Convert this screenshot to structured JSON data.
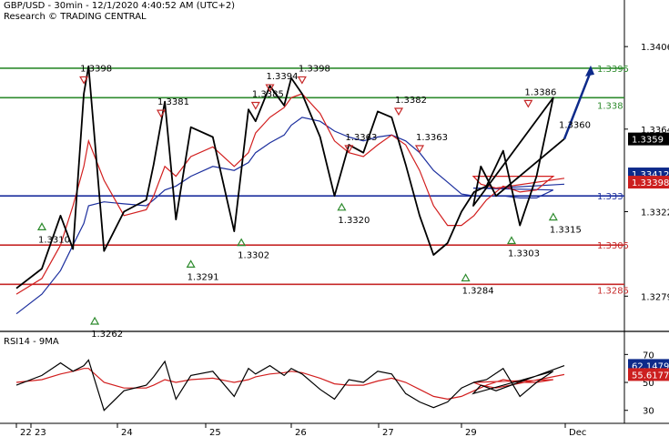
{
  "header": {
    "line1": "GBP/USD - 30min - 12/1/2020 4:40:52 AM (UTC+2)",
    "line2": "Research © TRADING CENTRAL"
  },
  "chart_data": [
    {
      "type": "line",
      "panel": "price",
      "ylim": [
        1.3262,
        1.3426
      ],
      "y_ticks": [
        "1.3406",
        "1.3364",
        "1.3322",
        "1.3279"
      ],
      "x_ticks": [
        "22",
        "23",
        "24",
        "25",
        "26",
        "27",
        "29",
        "Dec"
      ],
      "grid": false,
      "x": [
        "22 18:00",
        "23 00:00",
        "23 06:00",
        "23 10:00",
        "23 13:30",
        "23 15:00",
        "23 20:00",
        "24 02:00",
        "24 08:00",
        "24 10:00",
        "24 13:00",
        "24 16:00",
        "24 20:00",
        "25 02:00",
        "25 08:00",
        "25 12:00",
        "25 14:00",
        "25 18:00",
        "25 22:00",
        "26 00:00",
        "26 03:00",
        "26 08:00",
        "26 12:00",
        "26 16:00",
        "26 20:00",
        "27 00:00",
        "27 04:00",
        "27 08:00",
        "27 12:00",
        "27 16:00",
        "27 20:00",
        "29 00:00",
        "29 03:00",
        "29 06:00",
        "29 10:00",
        "29 14:00",
        "29 18:00",
        "29 22:00",
        "30 00:00",
        "30 02:00",
        "30 06:00",
        "Dec 00:00"
      ],
      "series": [
        {
          "values": [
            1.3283,
            1.3293,
            1.332,
            1.3303,
            1.3382,
            1.3396,
            1.3302,
            1.3322,
            1.3328,
            1.3346,
            1.3378,
            1.3318,
            1.3365,
            1.336,
            1.3312,
            1.3374,
            1.3368,
            1.3386,
            1.3376,
            1.339,
            1.3382,
            1.336,
            1.333,
            1.3356,
            1.3352,
            1.3373,
            1.337,
            1.3346,
            1.332,
            1.33,
            1.3306,
            1.3322,
            1.3332,
            1.3335,
            1.3353,
            1.3315,
            1.334,
            1.338,
            1.3325,
            1.3345,
            1.333,
            1.3359
          ]
        },
        {
          "values": [
            1.328,
            1.3288,
            1.3305,
            1.3325,
            1.3345,
            1.3358,
            1.3338,
            1.332,
            1.3323,
            1.333,
            1.3345,
            1.334,
            1.335,
            1.3355,
            1.3345,
            1.3352,
            1.3362,
            1.337,
            1.3375,
            1.338,
            1.3382,
            1.3372,
            1.3358,
            1.3352,
            1.335,
            1.3356,
            1.3361,
            1.3356,
            1.3343,
            1.3325,
            1.3315,
            1.3315,
            1.332,
            1.3328,
            1.3335,
            1.3332,
            1.3333,
            1.334,
            1.334,
            1.3336,
            1.3334,
            1.3339
          ]
        },
        {
          "values": [
            1.327,
            1.328,
            1.3292,
            1.3305,
            1.3316,
            1.3325,
            1.3327,
            1.3326,
            1.3325,
            1.3328,
            1.3333,
            1.3335,
            1.334,
            1.3345,
            1.3343,
            1.3347,
            1.3352,
            1.3357,
            1.3361,
            1.3366,
            1.337,
            1.3368,
            1.3363,
            1.336,
            1.3358,
            1.336,
            1.3361,
            1.3358,
            1.3352,
            1.3343,
            1.3337,
            1.3331,
            1.333,
            1.333,
            1.333,
            1.3329,
            1.3329,
            1.3333,
            1.3334,
            1.3334,
            1.3334,
            1.3336
          ]
        }
      ],
      "levels": [
        {
          "value": "1.3395",
          "color": "#2e8b2e",
          "dash": "solid"
        },
        {
          "value": "1.338",
          "color": "#2e8b2e",
          "dash": "solid"
        },
        {
          "value": "1.333",
          "color": "#1c2f9e",
          "dash": "solid"
        },
        {
          "value": "1.3305",
          "color": "#c62828",
          "dash": "solid"
        },
        {
          "value": "1.3285",
          "color": "#c62828",
          "dash": "solid"
        }
      ],
      "annotations": [
        {
          "label": "1.3398",
          "x": "23 13:30",
          "y": 1.3398,
          "marker": "down"
        },
        {
          "label": "1.3310",
          "x": "23 00:00",
          "y": 1.331,
          "marker": "up"
        },
        {
          "label": "1.3262",
          "x": "23 17:00",
          "y": 1.3262,
          "marker": "up"
        },
        {
          "label": "1.3381",
          "x": "24 12:00",
          "y": 1.3381,
          "marker": "down"
        },
        {
          "label": "1.3291",
          "x": "24 20:00",
          "y": 1.3291,
          "marker": "up"
        },
        {
          "label": "1.3385",
          "x": "25 14:00",
          "y": 1.3385,
          "marker": "down"
        },
        {
          "label": "1.3302",
          "x": "25 10:00",
          "y": 1.3302,
          "marker": "up"
        },
        {
          "label": "1.3394",
          "x": "25 18:00",
          "y": 1.3394,
          "marker": "down"
        },
        {
          "label": "1.3398",
          "x": "26 03:00",
          "y": 1.3398,
          "marker": "down"
        },
        {
          "label": "1.3363",
          "x": "26 16:00",
          "y": 1.3363,
          "marker": "down"
        },
        {
          "label": "1.3320",
          "x": "26 14:00",
          "y": 1.332,
          "marker": "up"
        },
        {
          "label": "1.3382",
          "x": "27 06:00",
          "y": 1.3382,
          "marker": "down"
        },
        {
          "label": "1.3363",
          "x": "27 12:00",
          "y": 1.3363,
          "marker": "down"
        },
        {
          "label": "1.3284",
          "x": "29 01:00",
          "y": 1.3284,
          "marker": "up"
        },
        {
          "label": "1.3303",
          "x": "29 12:00",
          "y": 1.3303,
          "marker": "up"
        },
        {
          "label": "1.3386",
          "x": "29 16:00",
          "y": 1.3386,
          "marker": "down"
        },
        {
          "label": "1.3315",
          "x": "29 22:00",
          "y": 1.3315,
          "marker": "up"
        },
        {
          "label": "1.3360",
          "x": "Dec 00:00",
          "y": 1.336,
          "marker": "none"
        }
      ],
      "badges": [
        {
          "value": "1.3359",
          "color": "#000000",
          "text_color": "#ffffff",
          "y": 1.3359
        },
        {
          "value": "1.33412",
          "color": "#0d2a8a",
          "text_color": "#ffffff",
          "y": 1.33412
        },
        {
          "value": "1.33398",
          "color": "#cc1f1f",
          "text_color": "#ffffff",
          "y": 1.33398
        }
      ],
      "target_arrow": {
        "color": "#0d2a8a",
        "to": 1.3395
      },
      "colors": {
        "price": "#000000",
        "ma_fast": "#d21f1f",
        "ma_slow": "#1c2f9e"
      }
    },
    {
      "type": "line",
      "panel": "rsi",
      "title": "RSI14 - 9MA",
      "ylim": [
        22,
        80
      ],
      "y_ticks": [
        "70",
        "50",
        "30"
      ],
      "x": [
        "22 18:00",
        "23 00:00",
        "23 06:00",
        "23 10:00",
        "23 13:30",
        "23 15:00",
        "23 20:00",
        "24 02:00",
        "24 08:00",
        "24 10:00",
        "24 13:00",
        "24 16:00",
        "24 20:00",
        "25 02:00",
        "25 08:00",
        "25 12:00",
        "25 14:00",
        "25 18:00",
        "25 22:00",
        "26 00:00",
        "26 03:00",
        "26 08:00",
        "26 12:00",
        "26 16:00",
        "26 20:00",
        "27 00:00",
        "27 04:00",
        "27 08:00",
        "27 12:00",
        "27 16:00",
        "27 20:00",
        "29 00:00",
        "29 03:00",
        "29 06:00",
        "29 10:00",
        "29 14:00",
        "29 18:00",
        "29 22:00",
        "30 00:00",
        "30 02:00",
        "30 06:00",
        "Dec 00:00"
      ],
      "series": [
        {
          "values": [
            48,
            55,
            64,
            58,
            62,
            66,
            30,
            44,
            48,
            54,
            65,
            38,
            55,
            58,
            40,
            60,
            56,
            62,
            55,
            60,
            56,
            45,
            38,
            52,
            50,
            58,
            56,
            42,
            36,
            32,
            36,
            46,
            50,
            52,
            60,
            40,
            50,
            58,
            42,
            48,
            44,
            62
          ]
        },
        {
          "values": [
            50,
            52,
            56,
            58,
            60,
            60,
            50,
            46,
            46,
            48,
            52,
            50,
            52,
            53,
            50,
            52,
            54,
            56,
            57,
            58,
            57,
            53,
            49,
            48,
            48,
            51,
            53,
            50,
            45,
            40,
            38,
            40,
            44,
            48,
            52,
            50,
            50,
            52,
            50,
            48,
            46,
            55.6
          ]
        }
      ],
      "badges": [
        {
          "value": "62.1479",
          "color": "#0d2a8a",
          "text_color": "#ffffff",
          "y": 62.1479
        },
        {
          "value": "55.6177",
          "color": "#cc1f1f",
          "text_color": "#ffffff",
          "y": 55.6177
        }
      ],
      "colors": {
        "rsi": "#000000",
        "ma": "#d21f1f"
      }
    }
  ]
}
